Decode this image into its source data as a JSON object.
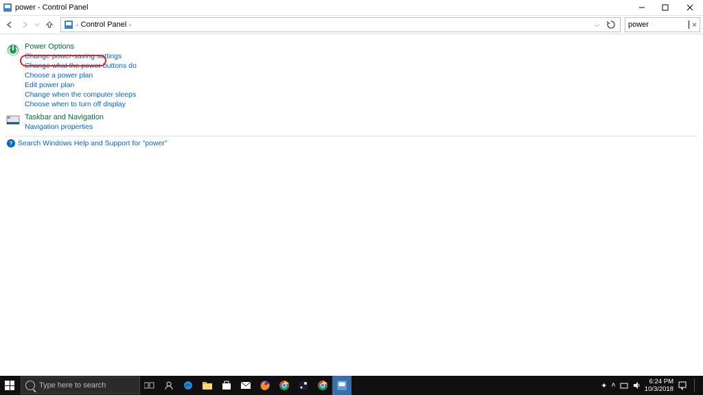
{
  "titlebar": {
    "title": "power - Control Panel"
  },
  "breadcrumb": {
    "root": "Control Panel"
  },
  "search": {
    "value": "power"
  },
  "category_power": {
    "title": "Power Options",
    "links": {
      "l0": "Change power-saving settings",
      "l1": "Change what the power buttons do",
      "l2": "Choose a power plan",
      "l3": "Edit power plan",
      "l4": "Change when the computer sleeps",
      "l5": "Choose when to turn off display"
    }
  },
  "category_taskbar": {
    "title": "Taskbar and Navigation",
    "link": "Navigation properties"
  },
  "help": {
    "text": "Search Windows Help and Support for \"power\""
  },
  "taskbar": {
    "search_placeholder": "Type here to search"
  },
  "tray": {
    "time": "6:24 PM",
    "date": "10/3/2018"
  }
}
